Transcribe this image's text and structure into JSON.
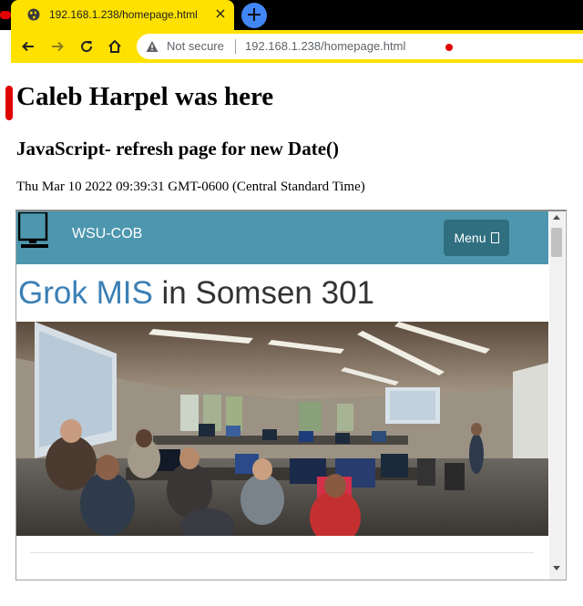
{
  "browser": {
    "tab_title": "192.168.1.238/homepage.html",
    "tab_close": "×",
    "new_tab": "+",
    "security_label": "Not secure",
    "url": "192.168.1.238/homepage.html",
    "accent_color": "#ffe100",
    "icons": {
      "back": "arrow-left-icon",
      "forward": "arrow-right-icon",
      "reload": "reload-icon",
      "home": "home-icon",
      "security": "warning-triangle-icon",
      "favicon": "globe-icon"
    }
  },
  "page": {
    "heading": "Caleb Harpel was here",
    "subheading": "JavaScript- refresh page for new Date()",
    "datetime": "Thu Mar 10 2022 09:39:31 GMT-0600 (Central Standard Time)"
  },
  "embedded_site": {
    "brand": "WSU-COB",
    "menu_label": "Menu",
    "heading_highlight": "Grok MIS",
    "heading_rest": " in Somsen 301",
    "navbar_color": "#4d97ae",
    "menu_button_color": "#2f6f80",
    "highlight_color": "#3a7fb5",
    "photo": "classroom-photo"
  }
}
